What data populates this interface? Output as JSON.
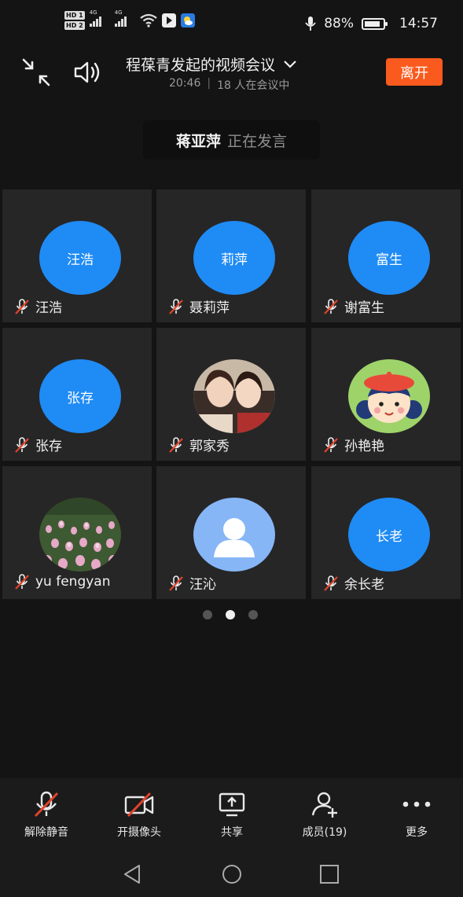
{
  "status_bar": {
    "hd1": "HD 1",
    "hd2": "HD 2",
    "network1": "4G",
    "network2": "4G",
    "battery": "88%",
    "battery_level": 0.88,
    "time": "14:57"
  },
  "header": {
    "title": "程葆青发起的视频会议",
    "duration": "20:46",
    "participants_text": "18 人在会议中",
    "leave_label": "离开"
  },
  "speaking": {
    "name": "蒋亚萍",
    "status": "正在发言"
  },
  "participants": [
    {
      "avatar_text": "汪浩",
      "name": "汪浩",
      "muted": true
    },
    {
      "avatar_text": "莉萍",
      "name": "聂莉萍",
      "muted": true
    },
    {
      "avatar_text": "富生",
      "name": "谢富生",
      "muted": true
    },
    {
      "avatar_text": "张存",
      "name": "张存",
      "muted": true
    },
    {
      "avatar_text": "",
      "name": "郭家秀",
      "muted": true,
      "avatar": "photo-two-women"
    },
    {
      "avatar_text": "",
      "name": "孙艳艳",
      "muted": true,
      "avatar": "cartoon-girl"
    },
    {
      "avatar_text": "",
      "name": "yu fengyan",
      "muted": true,
      "avatar": "tulip-field"
    },
    {
      "avatar_text": "",
      "name": "汪沁",
      "muted": true,
      "avatar": "default-person"
    },
    {
      "avatar_text": "长老",
      "name": "余长老",
      "muted": true
    }
  ],
  "pager": {
    "pages": 3,
    "current": 2
  },
  "toolbar": {
    "unmute": "解除静音",
    "camera": "开摄像头",
    "share": "共享",
    "members": "成员(19)",
    "more": "更多"
  },
  "colors": {
    "accent_blue": "#1f8bf5",
    "leave_orange": "#fa5a1e",
    "mute_red": "#e2432b",
    "background": "#141414",
    "tile": "#262626"
  }
}
